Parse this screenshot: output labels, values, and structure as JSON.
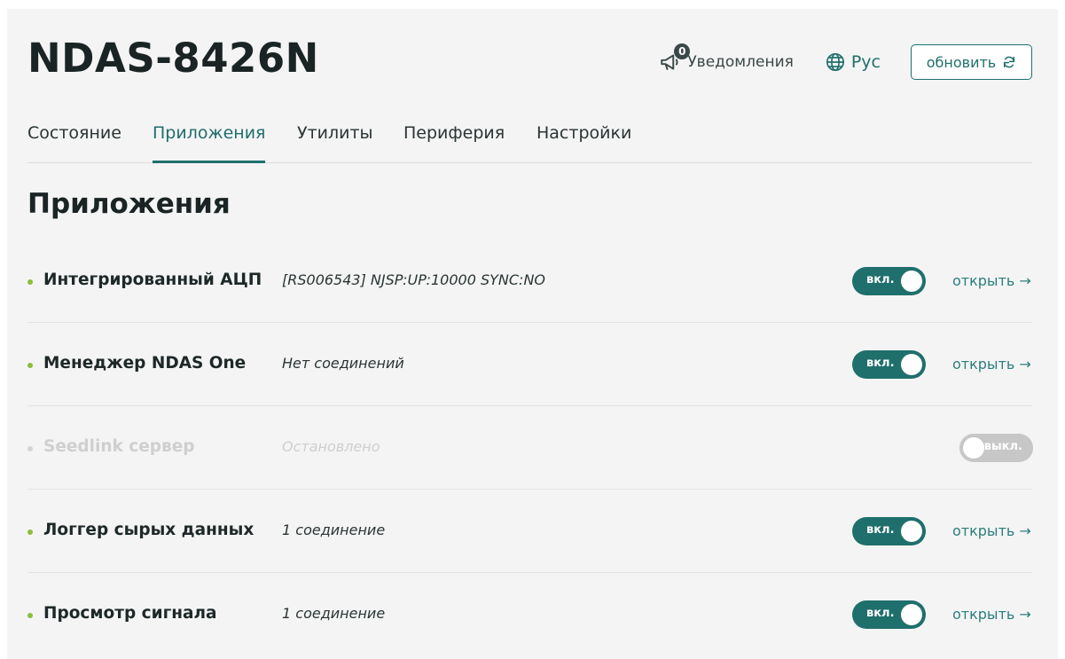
{
  "header": {
    "title": "NDAS-8426N",
    "notifications": {
      "label": "Уведомления",
      "count": "0"
    },
    "language": {
      "label": "Рус"
    },
    "refresh_label": "обновить"
  },
  "tabs": [
    {
      "label": "Состояние"
    },
    {
      "label": "Приложения",
      "active": true
    },
    {
      "label": "Утилиты"
    },
    {
      "label": "Периферия"
    },
    {
      "label": "Настройки"
    }
  ],
  "section_title": "Приложения",
  "apps": [
    {
      "name": "Интегрированный АЦП",
      "status": "[RS006543] NJSP:UP:10000 SYNC:NO",
      "toggle": "вкл.",
      "enabled": true,
      "open_label": "открыть"
    },
    {
      "name": "Менеджер NDAS One",
      "status": "Нет соединений",
      "toggle": "вкл.",
      "enabled": true,
      "open_label": "открыть"
    },
    {
      "name": "Seedlink сервер",
      "status": "Остановлено",
      "toggle": "выкл.",
      "enabled": false
    },
    {
      "name": "Логгер сырых данных",
      "status": "1 соединение",
      "toggle": "вкл.",
      "enabled": true,
      "open_label": "открыть"
    },
    {
      "name": "Просмотр сигнала",
      "status": "1 соединение",
      "toggle": "вкл.",
      "enabled": true,
      "open_label": "открыть"
    }
  ],
  "colors": {
    "accent": "#1f6f6c",
    "status_dot": "#8cbd3a",
    "toggle_off": "#c7c7c7"
  }
}
